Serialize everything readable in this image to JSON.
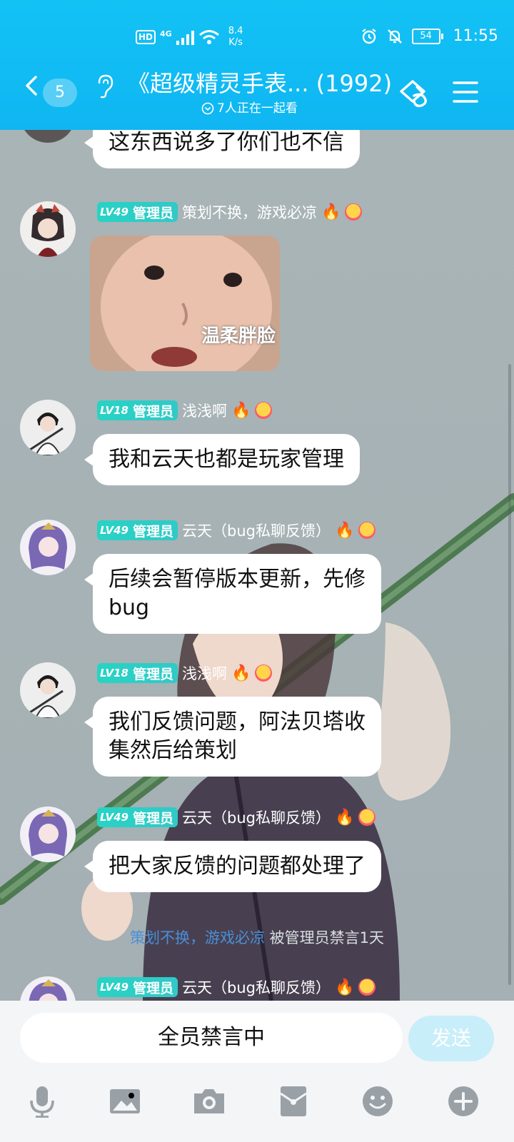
{
  "status_bar": {
    "hd": "HD",
    "network": "4G",
    "speed_value": "8.4",
    "speed_unit": "K/s",
    "battery": "54",
    "time": "11:55"
  },
  "header": {
    "back_count": "5",
    "title": "《超级精灵手表... (1992)",
    "subtitle": "7人正在一起看"
  },
  "messages": [
    {
      "text": "这东西说多了你们也不信"
    },
    {
      "level": "LV49",
      "role": "管理员",
      "nick": "策划不换，游戏必凉",
      "image_caption": "温柔胖脸"
    },
    {
      "level": "LV18",
      "role": "管理员",
      "nick": "浅浅啊",
      "text": "我和云天也都是玩家管理"
    },
    {
      "level": "LV49",
      "role": "管理员",
      "nick": "云天（bug私聊反馈）",
      "text1": "后续会暂停版本更新，先修",
      "text2": "bug"
    },
    {
      "level": "LV18",
      "role": "管理员",
      "nick": "浅浅啊",
      "text1": "我们反馈问题，阿法贝塔收",
      "text2": "集然后给策划"
    },
    {
      "level": "LV49",
      "role": "管理员",
      "nick": "云天（bug私聊反馈）",
      "text": "把大家反馈的问题都处理了"
    },
    {
      "level": "LV49",
      "role": "管理员",
      "nick": "云天（bug私聊反馈）"
    }
  ],
  "system_notice": {
    "user": "策划不换，游戏必凉",
    "action": " 被管理员禁言1天"
  },
  "input": {
    "placeholder": "全员禁言中",
    "send": "发送"
  },
  "colors": {
    "header": "#12c2f5",
    "tag": "#28d3c4",
    "notice_user": "#4a8fd8",
    "send_disabled": "#c8eefa"
  },
  "icons": [
    "back-icon",
    "ear-icon",
    "share-icon",
    "menu-icon",
    "mic-icon",
    "image-icon",
    "camera-icon",
    "redpacket-icon",
    "emoji-icon",
    "plus-icon",
    "fire-icon",
    "smile-icon"
  ]
}
